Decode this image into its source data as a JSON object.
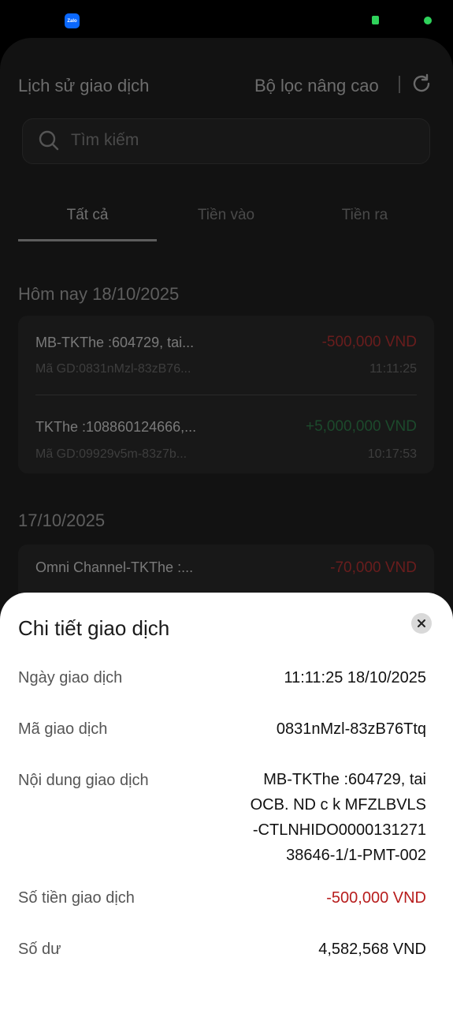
{
  "status_bar": {
    "app_icon_label": "Zalo",
    "icons": [
      "zalo-icon",
      "b-icon",
      "dot-indicator"
    ]
  },
  "header": {
    "title": "Lịch sử giao dịch",
    "filter_label": "Bộ lọc nâng cao"
  },
  "search": {
    "placeholder": "Tìm kiếm"
  },
  "tabs": [
    {
      "label": "Tất cả",
      "active": true
    },
    {
      "label": "Tiền vào",
      "active": false
    },
    {
      "label": "Tiền ra",
      "active": false
    }
  ],
  "sections": [
    {
      "date": "Hôm nay 18/10/2025",
      "transactions": [
        {
          "name": "MB-TKThe :604729, tai...",
          "amount": "-500,000 VND",
          "code": "Mã GD:0831nMzl-83zB76...",
          "time": "11:11:25"
        },
        {
          "name": "TKThe :108860124666,...",
          "amount": "+5,000,000 VND",
          "code": "Mã GD:09929v5m-83z7b...",
          "time": "10:17:53"
        }
      ]
    },
    {
      "date": "17/10/2025",
      "transactions": [
        {
          "name": "Omni Channel-TKThe :...",
          "amount": "-70,000 VND"
        }
      ]
    }
  ],
  "detail": {
    "title": "Chi tiết giao dịch",
    "rows": [
      {
        "label": "Ngày giao dịch",
        "value": "11:11:25 18/10/2025"
      },
      {
        "label": "Mã giao dịch",
        "value": "0831nMzl-83zB76Ttq"
      },
      {
        "label": "Nội dung giao dịch",
        "value": "MB-TKThe :604729, tai\nOCB. ND c k MFZLBVLS\n-CTLNHIDO0000131271\n38646-1/1-PMT-002"
      },
      {
        "label": "Số tiền giao dịch",
        "value": "-500,000 VND"
      },
      {
        "label": "Số dư",
        "value": "4,582,568 VND"
      }
    ]
  },
  "colors": {
    "negative": "#b71c1c",
    "positive": "#2e7d32",
    "sheet_bg": "#ffffff",
    "status_green": "#2fd25b",
    "zalo_blue": "#0a68ff"
  }
}
